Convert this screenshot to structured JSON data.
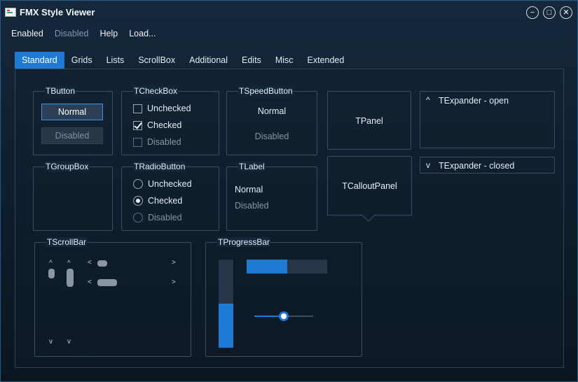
{
  "window": {
    "title": "FMX Style Viewer",
    "minimize_glyph": "−",
    "maximize_glyph": "□",
    "close_glyph": "✕"
  },
  "menu": [
    "Enabled",
    "Disabled",
    "Help",
    "Load..."
  ],
  "tabs": [
    "Standard",
    "Grids",
    "Lists",
    "ScrollBox",
    "Additional",
    "Edits",
    "Misc",
    "Extended"
  ],
  "active_tab": "Standard",
  "tbutton": {
    "legend": "TButton",
    "normal": "Normal",
    "disabled": "Disabled"
  },
  "tcheckbox": {
    "legend": "TCheckBox",
    "unchecked": "Unchecked",
    "checked": "Checked",
    "disabled": "Disabled"
  },
  "tspeedbutton": {
    "legend": "TSpeedButton",
    "normal": "Normal",
    "disabled": "Disabled"
  },
  "tpanel": {
    "label": "TPanel"
  },
  "texpander_open": {
    "label": "TExpander - open",
    "glyph": "^"
  },
  "texpander_closed": {
    "label": "TExpander - closed",
    "glyph": "v"
  },
  "tgroupbox": {
    "legend": "TGroupBox"
  },
  "tradiobutton": {
    "legend": "TRadioButton",
    "unchecked": "Unchecked",
    "checked": "Checked",
    "disabled": "Disabled"
  },
  "tlabel": {
    "legend": "TLabel",
    "normal": "Normal",
    "disabled": "Disabled"
  },
  "tcalloutpanel": {
    "label": "TCalloutPanel"
  },
  "tscrollbar": {
    "legend": "TScrollBar",
    "up": "^",
    "down": "v",
    "left": "<",
    "right": ">"
  },
  "tprogressbar": {
    "legend": "TProgressBar",
    "horizontal_progress": 0.5,
    "vertical_progress": 0.5,
    "trackbar_value": 0.5
  },
  "colors": {
    "accent": "#1f7ad6",
    "background": "#10202f",
    "border": "#3a4d61"
  }
}
